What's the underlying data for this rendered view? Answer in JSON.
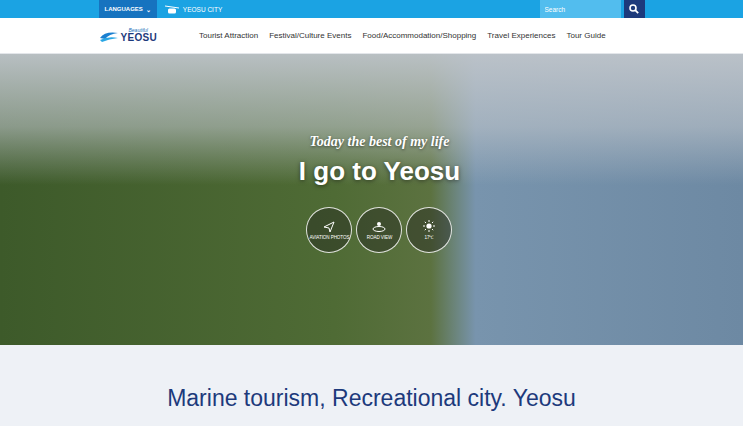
{
  "topbar": {
    "languages": "LANGUAGES",
    "languages_caret": "⌄",
    "city": "YEOSU CITY",
    "search": {
      "placeholder": "Search"
    }
  },
  "logo": {
    "small": "Beautiful",
    "big": "YEOSU"
  },
  "nav": [
    {
      "label": "Tourist Attraction"
    },
    {
      "label": "Festival/Culture Events"
    },
    {
      "label": "Food/Accommodation/Shopping"
    },
    {
      "label": "Travel Experiences"
    },
    {
      "label": "Tour Guide"
    }
  ],
  "hero": {
    "tagline": "Today the best of my life",
    "title": "I go to Yeosu",
    "buttons": [
      {
        "label": "AVIATION PHOTOS",
        "kind": "plane"
      },
      {
        "label": "ROAD VIEW",
        "kind": "road"
      },
      {
        "label": "17℃",
        "kind": "sun"
      }
    ]
  },
  "section": {
    "heading": "Marine tourism, Recreational city. Yeosu"
  }
}
